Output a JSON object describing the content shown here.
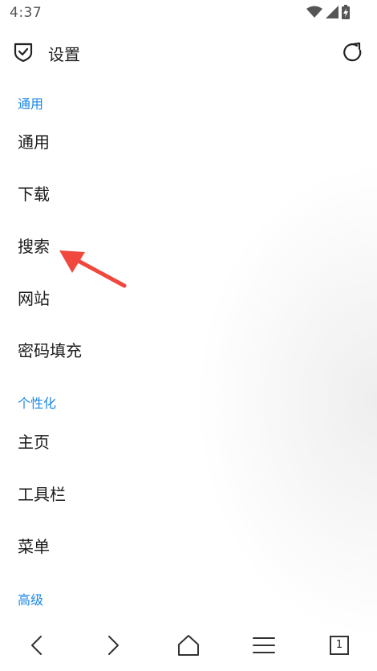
{
  "status_bar": {
    "time": "4:37",
    "icons": [
      "wifi-icon",
      "signal-icon",
      "battery-charging-icon"
    ]
  },
  "header": {
    "title": "设置",
    "left_icon": "shield-check-icon",
    "right_icon": "refresh-icon"
  },
  "sections": [
    {
      "header": "通用",
      "items": [
        "通用",
        "下载",
        "搜索",
        "网站",
        "密码填充"
      ]
    },
    {
      "header": "个性化",
      "items": [
        "主页",
        "工具栏",
        "菜单"
      ]
    },
    {
      "header": "高级",
      "items": []
    }
  ],
  "bottom_nav": {
    "buttons": [
      "back-icon",
      "forward-icon",
      "home-icon",
      "menu-icon",
      "tabs-icon"
    ],
    "tab_count": "1"
  },
  "colors": {
    "accent": "#1e88e5",
    "annotation": "#f0483e",
    "text": "#1a1a1a"
  }
}
